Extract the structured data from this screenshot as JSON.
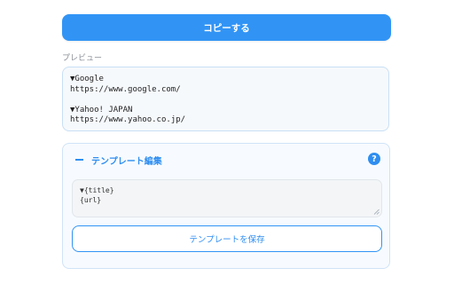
{
  "copy_button": {
    "label": "コピーする"
  },
  "preview": {
    "label": "プレビュー",
    "lines": [
      "▼Google",
      "https://www.google.com/",
      "",
      "▼Yahoo! JAPAN",
      "https://www.yahoo.co.jp/"
    ]
  },
  "template_panel": {
    "collapse_icon": "minus-icon",
    "title": "テンプレート編集",
    "help_icon": "question-icon",
    "help_glyph": "?",
    "template_lines": [
      "▼{title}",
      "{url}"
    ],
    "save_label": "テンプレートを保存"
  },
  "colors": {
    "accent": "#3194f5",
    "panel_border": "#cfe3f7",
    "preview_bg": "#f6f9fc"
  }
}
